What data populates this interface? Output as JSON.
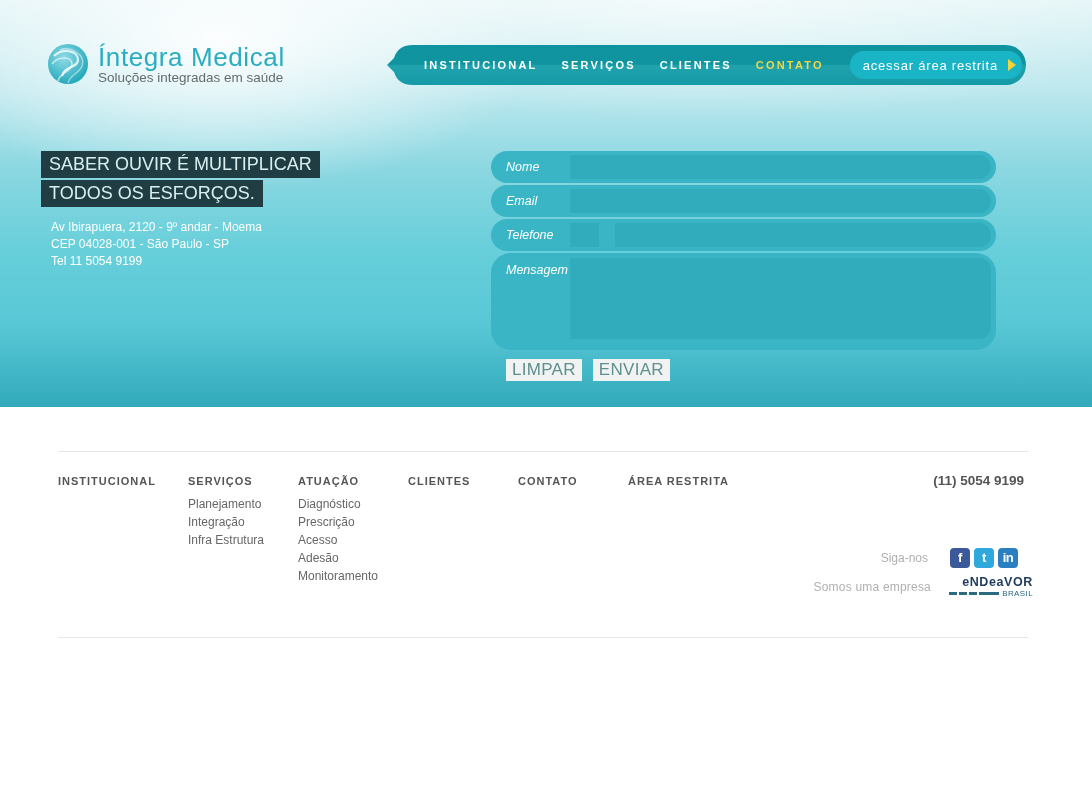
{
  "header": {
    "brand": "Íntegra Medical",
    "tagline": "Soluções integradas em saúde"
  },
  "nav": {
    "items": [
      {
        "label": "INSTITUCIONAL",
        "selected": false
      },
      {
        "label": "SERVIÇOS",
        "selected": false
      },
      {
        "label": "CLIENTES",
        "selected": false
      },
      {
        "label": "CONTATO",
        "selected": true
      }
    ],
    "restricted_button": "acessar área restrita"
  },
  "hero": {
    "slogan_lines": [
      "SABER OUVIR É MULTIPLICAR",
      "TODOS OS ESFORÇOS."
    ],
    "address_lines": [
      "Av Ibirapuera, 2120 - 9º andar - Moema",
      "CEP 04028-001 - São Paulo - SP",
      "Tel 11 5054 9199"
    ]
  },
  "contact_form": {
    "fields": [
      {
        "kind": "text",
        "label": "Nome"
      },
      {
        "kind": "text",
        "label": "Email"
      },
      {
        "kind": "phone",
        "label": "Telefone"
      },
      {
        "kind": "textarea",
        "label": "Mensagem"
      }
    ],
    "buttons": [
      "LIMPAR",
      "ENVIAR"
    ]
  },
  "footer": {
    "columns": [
      {
        "heading": "INSTITUCIONAL"
      },
      {
        "heading": "SERVIÇOS",
        "links": [
          "Planejamento",
          "Integração",
          "Infra Estrutura"
        ]
      },
      {
        "heading": "ATUAÇÃO",
        "links": [
          "Diagnóstico",
          "Prescrição",
          "Acesso",
          "Adesão",
          "Monitoramento"
        ]
      },
      {
        "heading": "CLIENTES"
      },
      {
        "heading": "CONTATO"
      },
      {
        "heading": "ÁREA RESTRITA"
      }
    ],
    "phone": "(11) 5054 9199",
    "follow_label": "Siga-nos",
    "social_links": [
      {
        "label": "f",
        "color": "#3b5998"
      },
      {
        "label": "t",
        "color": "#2fa8dc"
      },
      {
        "label": "in",
        "color": "#2a7fc0"
      }
    ],
    "partner_label": "Somos uma empresa",
    "partner_logo": {
      "wordmark": "eNDeaVOR",
      "subtext": "BRASIL"
    }
  }
}
